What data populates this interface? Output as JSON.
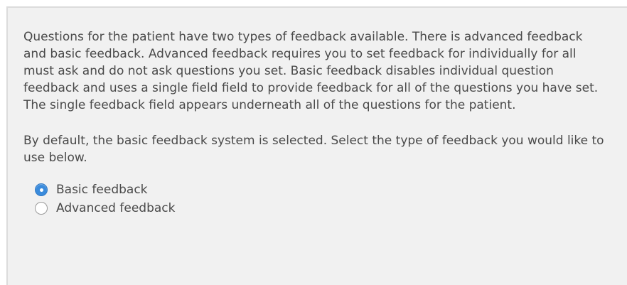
{
  "feedback_panel": {
    "paragraphs": [
      "Questions for the patient have two types of feedback available. There is advanced feedback and basic feedback. Advanced feedback requires you to set feedback for individually for all must ask and do not ask questions you set. Basic feedback disables individual question feedback and uses a single field field to provide feedback for all of the questions you have set. The single feedback field appears underneath all of the questions for the patient.",
      "By default, the basic feedback system is selected. Select the type of feedback you would like to use below."
    ],
    "options": [
      {
        "label": "Basic feedback",
        "selected": true
      },
      {
        "label": "Advanced feedback",
        "selected": false
      }
    ],
    "colors": {
      "panel_background": "#f1f1f1",
      "text": "#4a4a4a",
      "radio_selected": "#3a8bdc"
    }
  }
}
